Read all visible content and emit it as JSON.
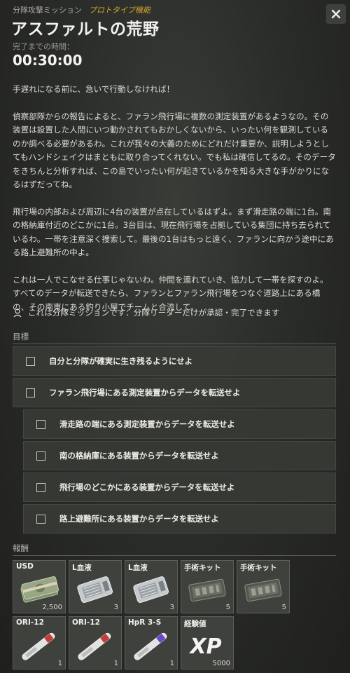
{
  "header": {
    "subtitle": "分隊攻撃ミッション",
    "prototype_tag": "プロトタイプ機能",
    "title": "アスファルトの荒野"
  },
  "time": {
    "label": "完了までの時間：",
    "value": "00:30:00"
  },
  "description": [
    "手遅れになる前に、急いで行動しなければ！",
    "偵察部隊からの報告によると、ファラン飛行場に複数の測定装置があるようなの。その装置は設置した人間にいつ動かされてもおかしくないから、いったい何を観測しているのか調べる必要があるわ。これが我々の大義のためにどれだけ重要か、説明しようとしてもハンドシェイクはまともに取り合ってくれない。でも私は確信してるの。そのデータをきちんと分析すれば、この島でいったい何が起きているかを知る大きな手がかりになるはずだってね。",
    "飛行場の内部および周辺に4台の装置が点在しているはずよ。まず滑走路の端に1台。南の格納庫付近のどこかに1台。3台目は、現在飛行場を占拠している集団に持ち去られているわ。一帯を注意深く捜索して。最後の1台はもっと遠く、ファランに向かう途中にある路上避難所の中よ。",
    "これは一人でこなせる仕事じゃないわ。仲間を連れていき、協力して一帯を探すのよ。すべてのデータが転送できたら、ファランとファラン飛行場をつなぐ道路上にある橋の、その南東にある釣り小屋でチームと合流して。"
  ],
  "squad_note": "これは分隊ミッションです：分隊リーダーだけが承認・完了できます",
  "objectives_label": "目標",
  "objectives": [
    {
      "label": "自分と分隊が確実に生き残るようにせよ",
      "indent": false
    },
    {
      "label": "ファラン飛行場にある測定装置からデータを転送せよ",
      "indent": false
    },
    {
      "label": "滑走路の端にある測定装置からデータを転送せよ",
      "indent": true
    },
    {
      "label": "南の格納庫にある装置からデータを転送せよ",
      "indent": true
    },
    {
      "label": "飛行場のどこかにある装置からデータを転送せよ",
      "indent": true
    },
    {
      "label": "路上避難所にある装置からデータを転送せよ",
      "indent": true
    }
  ],
  "rewards_label": "報酬",
  "rewards": [
    {
      "name": "USD",
      "qty": "2,500",
      "icon": "cash-stack-icon"
    },
    {
      "name": "L血液",
      "qty": "3",
      "icon": "blood-bag-icon"
    },
    {
      "name": "L血液",
      "qty": "3",
      "icon": "blood-bag-icon"
    },
    {
      "name": "手術キット",
      "qty": "5",
      "icon": "surgical-kit-icon"
    },
    {
      "name": "手術キット",
      "qty": "5",
      "icon": "surgical-kit-icon"
    },
    {
      "name": "ORI-12",
      "qty": "1",
      "icon": "injector-icon"
    },
    {
      "name": "ORI-12",
      "qty": "1",
      "icon": "injector-icon"
    },
    {
      "name": "HpR 3-S",
      "qty": "1",
      "icon": "injector-purple-icon"
    },
    {
      "name": "経験値",
      "qty": "5000",
      "icon": "xp-icon"
    }
  ]
}
